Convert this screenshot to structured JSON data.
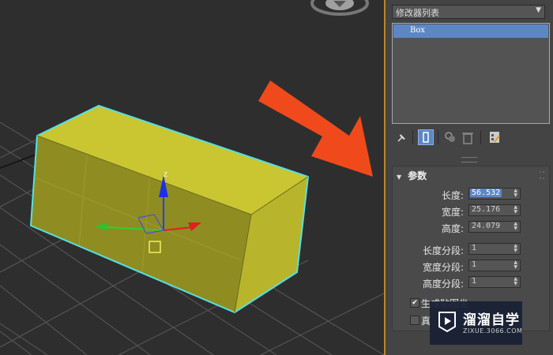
{
  "modifier_panel": {
    "modifier_list_label": "修改器列表",
    "stack_items": [
      "Box"
    ]
  },
  "parameters": {
    "title": "参数",
    "fields": [
      {
        "label": "长度:",
        "value": "56.532",
        "selected": true
      },
      {
        "label": "宽度:",
        "value": "25.176",
        "selected": false
      },
      {
        "label": "高度:",
        "value": "24.079",
        "selected": false
      }
    ],
    "segments": [
      {
        "label": "长度分段:",
        "value": "1"
      },
      {
        "label": "宽度分段:",
        "value": "1"
      },
      {
        "label": "高度分段:",
        "value": "1"
      }
    ],
    "checkboxes": [
      {
        "label": "生成贴图坐",
        "checked": true
      },
      {
        "label": "真",
        "checked": false
      }
    ]
  },
  "viewport": {
    "box_color": "#b5b328",
    "selection_color": "#57e0e0",
    "arrow_color": "#f04a1c",
    "gizmo_z_label": "Z"
  },
  "watermark": {
    "title": "溜溜自学",
    "url": "ZIXUE.3066.COM"
  }
}
